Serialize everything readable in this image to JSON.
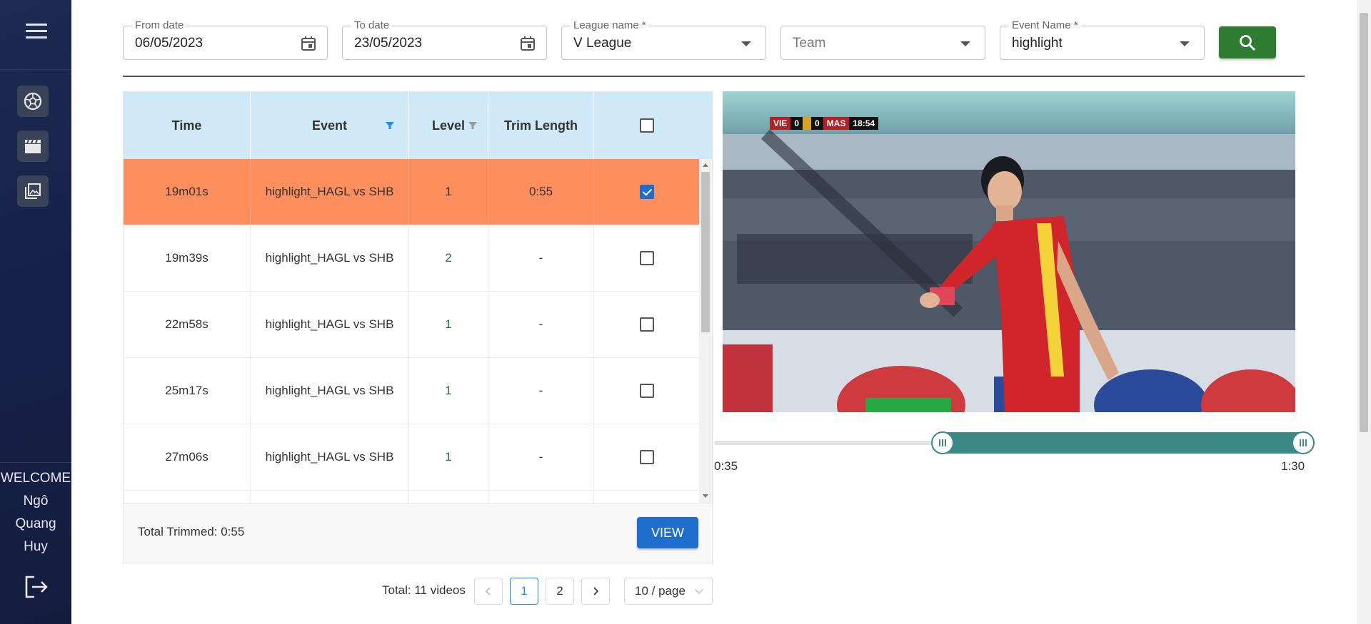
{
  "sidebar": {
    "nav_icons": [
      "soccer-ball-icon",
      "movie-clapper-icon",
      "image-gallery-icon"
    ],
    "welcome": [
      "WELCOME",
      "Ngô",
      "Quang",
      "Huy"
    ]
  },
  "filters": {
    "from_date": {
      "label": "From date",
      "value": "06/05/2023"
    },
    "to_date": {
      "label": "To date",
      "value": "23/05/2023"
    },
    "league": {
      "label": "League name *",
      "value": "V League"
    },
    "team": {
      "placeholder": "Team"
    },
    "event_name": {
      "label": "Event Name *",
      "value": "highlight"
    }
  },
  "table": {
    "headers": [
      "Time",
      "Event",
      "Level",
      "Trim Length"
    ],
    "rows": [
      {
        "time": "19m01s",
        "event": "highlight_HAGL vs SHB",
        "level": "1",
        "trim": "0:55",
        "checked": true
      },
      {
        "time": "19m39s",
        "event": "highlight_HAGL vs SHB",
        "level": "2",
        "trim": "-",
        "checked": false
      },
      {
        "time": "22m58s",
        "event": "highlight_HAGL vs SHB",
        "level": "1",
        "trim": "-",
        "checked": false
      },
      {
        "time": "25m17s",
        "event": "highlight_HAGL vs SHB",
        "level": "1",
        "trim": "-",
        "checked": false
      },
      {
        "time": "27m06s",
        "event": "highlight_HAGL vs SHB",
        "level": "1",
        "trim": "-",
        "checked": false
      }
    ],
    "total_trimmed": "Total Trimmed: 0:55",
    "view_label": "VIEW"
  },
  "pagination": {
    "total": "Total: 11 videos",
    "pages": [
      "1",
      "2"
    ],
    "current": "1",
    "page_size": "10 / page"
  },
  "video": {
    "scorebug": {
      "home": "VIE",
      "home_score": "0",
      "away_score": "0",
      "away": "MAS",
      "clock": "18:54"
    }
  },
  "trim_range": {
    "start_label": "0:35",
    "end_label": "1:30"
  },
  "colors": {
    "selected_row": "#fd8e5d",
    "search_button": "#2e7d32",
    "view_button": "#1e6ed0",
    "slider": "#3b8a86",
    "table_header": "#cfe9f7"
  }
}
